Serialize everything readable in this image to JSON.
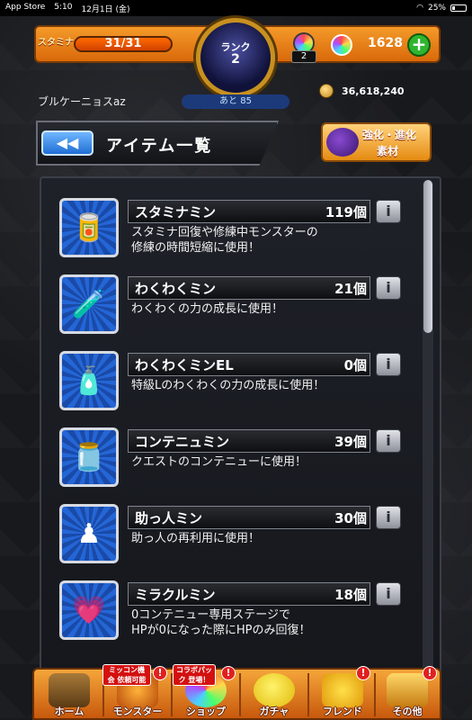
{
  "status_bar": {
    "carrier": "App Store",
    "time": "5:10",
    "date": "12月1日 (金)",
    "battery": "25%"
  },
  "header": {
    "stamina_label": "スタミナ",
    "stamina_value": "31/31",
    "rank_label": "ランク",
    "rank_value": "2",
    "rank_next": "あと 85",
    "orb_badge_count": "2",
    "orb_count": "1628",
    "player_name": "ブルケーニョスaz",
    "coins": "36,618,240"
  },
  "title_bar": {
    "back_icon": "back-arrow-icon",
    "title": "アイテム一覧",
    "evolve_line1": "強化・進化",
    "evolve_line2": "素材"
  },
  "items": [
    {
      "name": "スタミナミン",
      "qty": "119個",
      "desc_line1": "スタミナ回復や修練中モンスターの",
      "desc_line2": "修練の時間短縮に使用！",
      "icon": "stamina-can-icon"
    },
    {
      "name": "わくわくミン",
      "qty": "21個",
      "desc_line1": "わくわくの力の成長に使用！",
      "desc_line2": "",
      "icon": "waku-bottle-icon"
    },
    {
      "name": "わくわくミンEL",
      "qty": "0個",
      "desc_line1": "特級Lのわくわくの力の成長に使用！",
      "desc_line2": "",
      "icon": "waku-el-bottle-icon"
    },
    {
      "name": "コンテニュミン",
      "qty": "39個",
      "desc_line1": "クエストのコンテニューに使用！",
      "desc_line2": "",
      "icon": "continue-jar-icon"
    },
    {
      "name": "助っ人ミン",
      "qty": "30個",
      "desc_line1": "助っ人の再利用に使用！",
      "desc_line2": "",
      "icon": "helper-piece-icon"
    },
    {
      "name": "ミラクルミン",
      "qty": "18個",
      "desc_line1": "0コンテニュー専用ステージで",
      "desc_line2": "HPが0になった際にHPのみ回復！",
      "icon": "miracle-heart-icon"
    }
  ],
  "bottom_nav": {
    "home": "ホーム",
    "monster": "モンスター",
    "monster_ribbon": "ミッコン機会 依頼可能",
    "shop": "ショップ",
    "shop_ribbon": "コラボパック 登場！",
    "gacha": "ガチャ",
    "friend": "フレンド",
    "other": "その他",
    "excl": "!"
  },
  "colors": {
    "accent_orange": "#f49a2a",
    "item_icon_blue": "#2466d6",
    "panel_dark": "#1e2128"
  }
}
